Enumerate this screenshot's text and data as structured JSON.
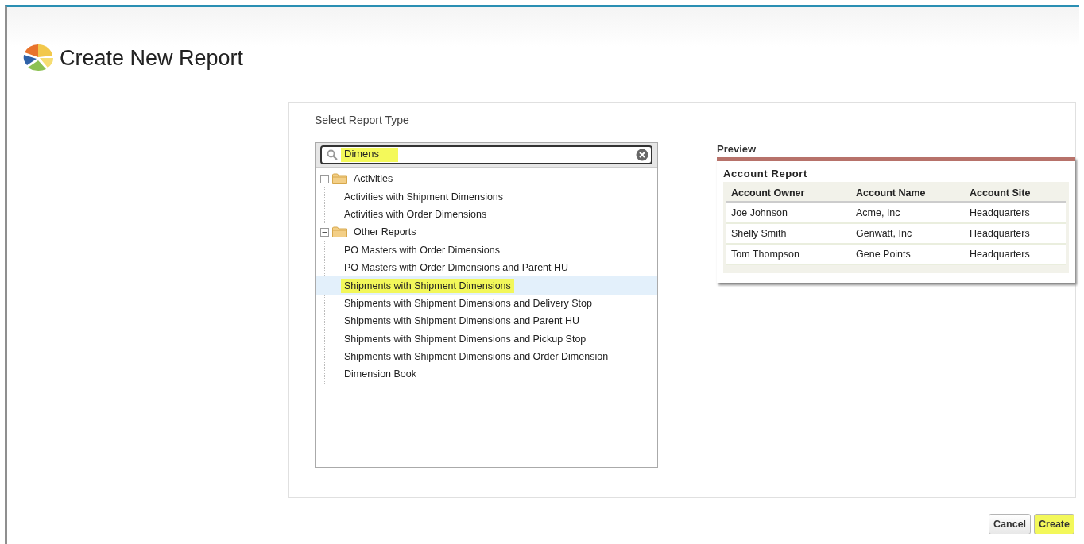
{
  "page": {
    "title": "Create New Report"
  },
  "panel": {
    "heading": "Select Report Type"
  },
  "search": {
    "value": "Dimens",
    "highlighted": true
  },
  "tree": [
    {
      "label": "Activities",
      "kind": "folder",
      "expanded": true,
      "selected": false,
      "children": [
        {
          "label": "Activities with Shipment Dimensions",
          "kind": "report",
          "selected": false
        },
        {
          "label": "Activities with Order Dimensions",
          "kind": "report",
          "selected": false
        }
      ]
    },
    {
      "label": "Other Reports",
      "kind": "folder",
      "expanded": true,
      "selected": false,
      "children": [
        {
          "label": "PO Masters with Order Dimensions",
          "kind": "report",
          "selected": false
        },
        {
          "label": "PO Masters with Order Dimensions and Parent HU",
          "kind": "report",
          "selected": false
        },
        {
          "label": "Shipments with Shipment Dimensions",
          "kind": "report",
          "selected": true
        },
        {
          "label": "Shipments with Shipment Dimensions and Delivery Stop",
          "kind": "report",
          "selected": false
        },
        {
          "label": "Shipments with Shipment Dimensions and Parent HU",
          "kind": "report",
          "selected": false
        },
        {
          "label": "Shipments with Shipment Dimensions and Pickup Stop",
          "kind": "report",
          "selected": false
        },
        {
          "label": "Shipments with Shipment Dimensions and Order Dimension",
          "kind": "report",
          "selected": false
        },
        {
          "label": "Dimension Book",
          "kind": "report",
          "selected": false
        }
      ]
    }
  ],
  "preview": {
    "heading": "Preview",
    "title": "Account Report",
    "columns": [
      "Account  Owner",
      "Account Name",
      "Account Site"
    ],
    "rows": [
      [
        "Joe Johnson",
        "Acme, Inc",
        "Headquarters"
      ],
      [
        "Shelly Smith",
        "Genwatt, Inc",
        "Headquarters"
      ],
      [
        "Tom Thompson",
        "Gene Points",
        "Headquarters"
      ]
    ]
  },
  "buttons": [
    {
      "label": "Cancel",
      "highlighted": false
    },
    {
      "label": "Create",
      "highlighted": true
    }
  ]
}
